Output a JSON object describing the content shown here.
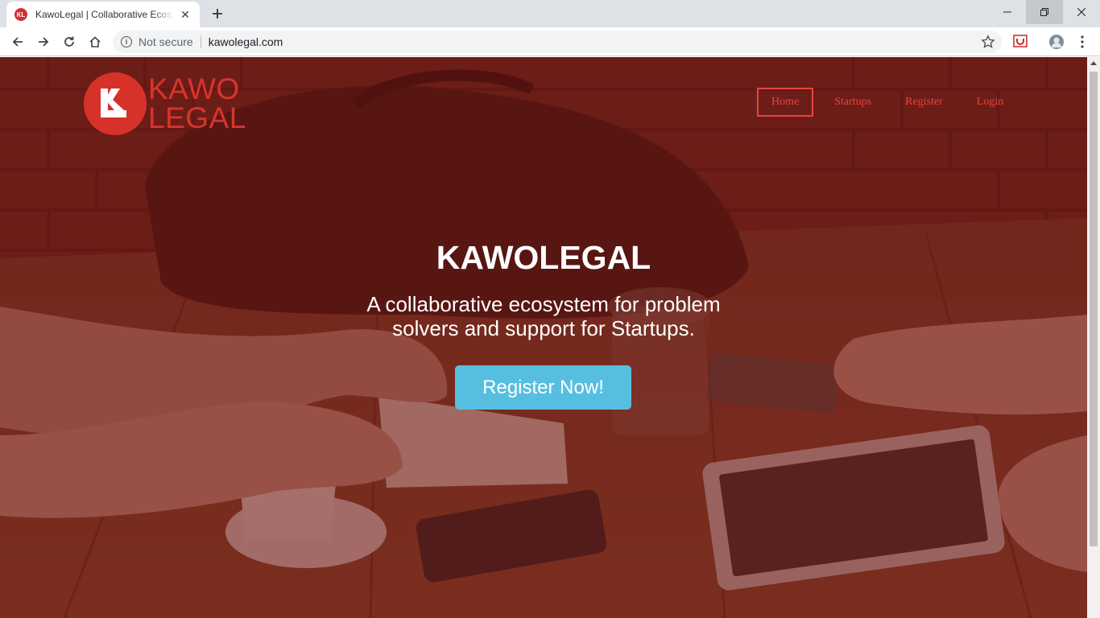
{
  "browser": {
    "tab_title": "KawoLegal | Collaborative Ecosystem",
    "favicon_text": "KL",
    "new_tab_icon": "plus-icon",
    "security_label": "Not secure",
    "url": "kawolegal.com"
  },
  "site": {
    "logo_line1": "KAWO",
    "logo_line2": "LEGAL",
    "nav": [
      {
        "label": "Home",
        "active": true
      },
      {
        "label": "Startups",
        "active": false
      },
      {
        "label": "Register",
        "active": false
      },
      {
        "label": "Login",
        "active": false
      }
    ],
    "hero_title": "KAWOLEGAL",
    "hero_subtitle": "A collaborative ecosystem for problem solvers and support for Startups.",
    "cta_label": "Register Now!"
  },
  "colors": {
    "brand_red": "#d7322a",
    "cta_blue": "#56bfe0"
  }
}
